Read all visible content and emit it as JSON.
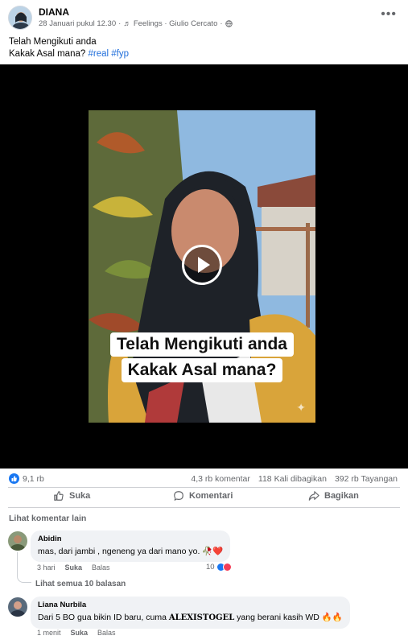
{
  "post": {
    "author": "DIANA",
    "timestamp": "28 Januari pukul 12.30",
    "music_note": "♬",
    "audio_title": "Feelings · Giulio Cercato",
    "privacy_icon": "globe-icon",
    "caption_line1": "Telah Mengikuti anda",
    "caption_line2_text": "Kakak Asal mana?",
    "hashtags": "#real #fyp"
  },
  "video": {
    "overlay_line1": "Telah Mengikuti anda",
    "overlay_line2": "Kakak Asal mana?"
  },
  "stats": {
    "likes": "9,1 rb",
    "comments": "4,3 rb komentar",
    "shares": "118 Kali dibagikan",
    "views": "392 rb Tayangan"
  },
  "actions": {
    "like": "Suka",
    "comment": "Komentari",
    "share": "Bagikan"
  },
  "comments_section": {
    "see_more": "Lihat komentar lain",
    "see_all_replies": "Lihat semua 10 balasan"
  },
  "comments": [
    {
      "name": "Abidin",
      "text": "mas, dari jambi , ngeneng ya dari mano yo. 🥀❤️",
      "time": "3 hari",
      "like": "Suka",
      "reply": "Balas",
      "reactions": "10"
    },
    {
      "name": "Liana Nurbila",
      "text_pre": "Dari 5 BO gua bikin ID baru, cuma ",
      "text_brand": "ALEXISTOGEL",
      "text_post": " yang berani kasih WD 🔥🔥",
      "time": "1 menit",
      "like": "Suka",
      "reply": "Balas"
    }
  ],
  "colors": {
    "accent": "#1877f2",
    "hashtag": "#216fdb",
    "muted": "#65676b",
    "bubble": "#f0f2f5"
  }
}
